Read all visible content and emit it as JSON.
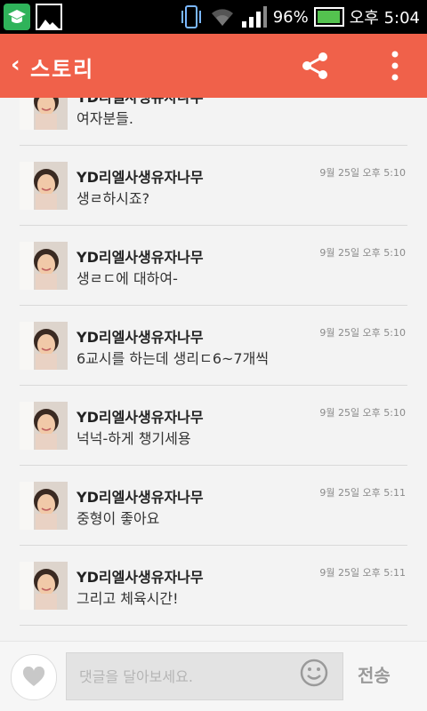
{
  "status": {
    "battery": "96%",
    "battery_level": 0.96,
    "time_label": "오후 5:04"
  },
  "header": {
    "back_label": "‹",
    "title": "스토리"
  },
  "comments": [
    {
      "name": "YD리엘사생유자나무",
      "time": "",
      "text": "여자분들."
    },
    {
      "name": "YD리엘사생유자나무",
      "time": "9월 25일 오후 5:10",
      "text": "생ㄹ하시죠?"
    },
    {
      "name": "YD리엘사생유자나무",
      "time": "9월 25일 오후 5:10",
      "text": "생ㄹㄷ에 대하여-"
    },
    {
      "name": "YD리엘사생유자나무",
      "time": "9월 25일 오후 5:10",
      "text": "6교시를 하는데 생리ㄷ6~7개씩"
    },
    {
      "name": "YD리엘사생유자나무",
      "time": "9월 25일 오후 5:10",
      "text": "넉넉-하게 챙기세용"
    },
    {
      "name": "YD리엘사생유자나무",
      "time": "9월 25일 오후 5:11",
      "text": "중형이 좋아요"
    },
    {
      "name": "YD리엘사생유자나무",
      "time": "9월 25일 오후 5:11",
      "text": "그리고 체육시간!"
    }
  ],
  "composer": {
    "placeholder": "댓글을 달아보세요.",
    "send_label": "전송"
  }
}
